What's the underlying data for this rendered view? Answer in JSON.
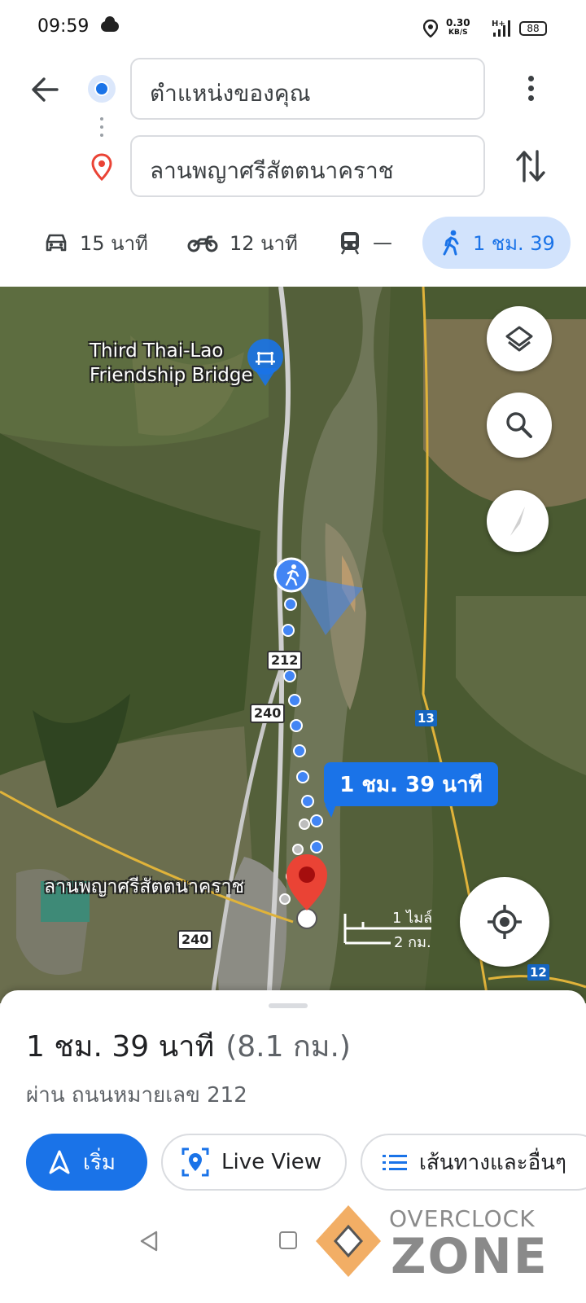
{
  "status_bar": {
    "time": "09:59",
    "net_speed": "0.30",
    "net_unit": "KB/S",
    "battery": "88"
  },
  "directions": {
    "origin": "ตำแหน่งของคุณ",
    "destination": "ลานพญาศรีสัตตนาคราช"
  },
  "modes": [
    {
      "name": "car",
      "label": "15 นาที"
    },
    {
      "name": "motorcycle",
      "label": "12 นาที"
    },
    {
      "name": "transit",
      "label": "—"
    },
    {
      "name": "walk",
      "label": "1 ชม. 39",
      "selected": true
    }
  ],
  "map": {
    "poi_label_line1": "Third Thai-Lao",
    "poi_label_line2": "Friendship Bridge",
    "destination_label": "ลานพญาศรีสัตตนาคราช",
    "route_badge": "1 ชม. 39 นาที",
    "road_212": "212",
    "road_240_a": "240",
    "road_240_b": "240",
    "hwy_13": "13",
    "hwy_12": "12",
    "scale_miles": "1 ไมล์",
    "scale_km": "2 กม.",
    "colors": {
      "route": "#4285f4",
      "pin": "#ea4335",
      "river": "#6f7658"
    }
  },
  "summary": {
    "duration": "1 ชม. 39 นาที",
    "distance": "(8.1 กม.)",
    "via": "ผ่าน ถนนหมายเลข 212"
  },
  "actions": {
    "start": "เริ่ม",
    "live_view": "Live View",
    "steps": "เส้นทางและอื่นๆ"
  },
  "watermark": {
    "line1": "OVERCLOCK",
    "line2": "ZONE"
  }
}
